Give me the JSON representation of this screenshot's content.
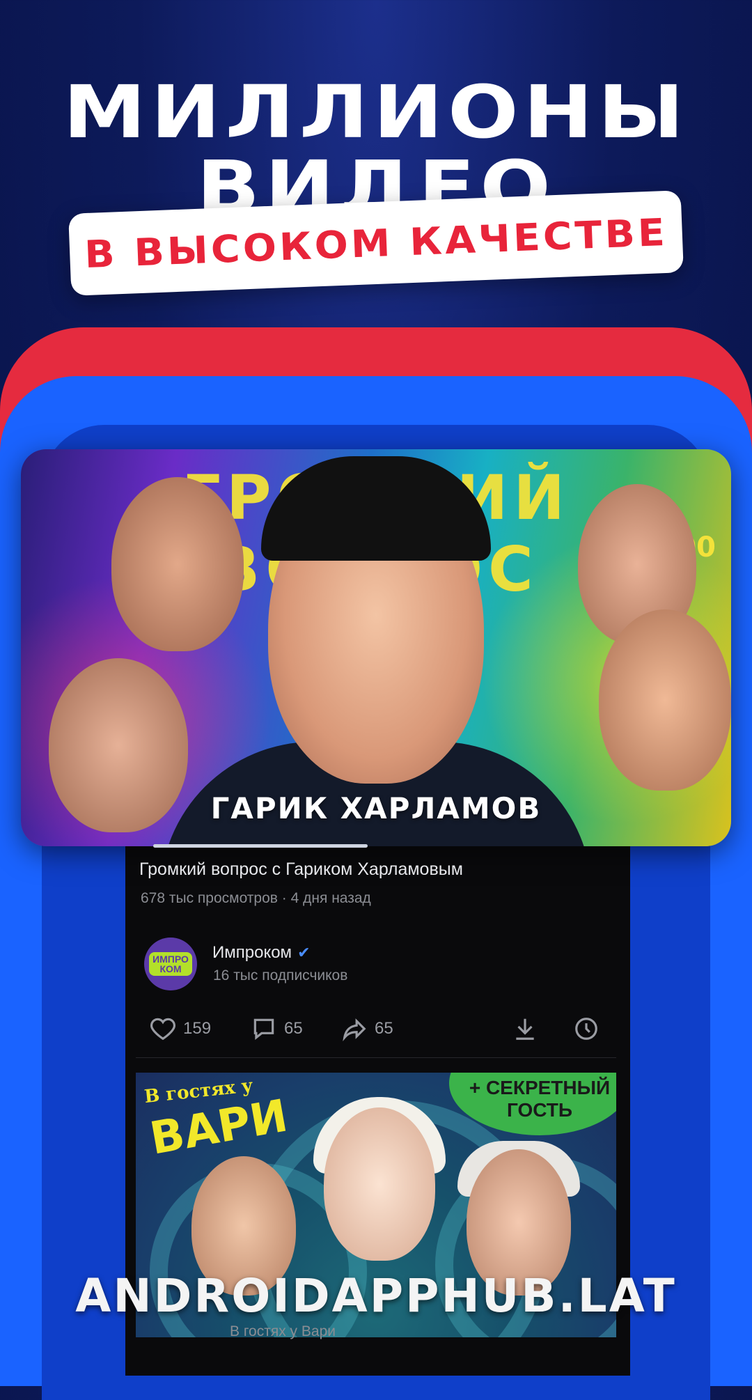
{
  "promo": {
    "line1": "МИЛЛИОНЫ",
    "line2": "ВИДЕО",
    "highlight": "В ВЫСОКОМ КАЧЕСТВЕ"
  },
  "colors": {
    "accent_red": "#e8243a",
    "frame_red": "#e52b3f",
    "frame_blue": "#1a63ff",
    "background": "#0d1a5a",
    "verified": "#4a8dff"
  },
  "video": {
    "thumbnail_title": "ГРОМКИЙ ВОПРОС",
    "thumbnail_tag": "≠100",
    "thumbnail_caption": "ГАРИК ХАРЛАМОВ",
    "progress_fraction": 0.3,
    "title": "Громкий вопрос с Гариком Харламовым",
    "views": "678 тыс просмотров",
    "separator": "·",
    "age": "4 дня назад"
  },
  "channel": {
    "avatar_text_top": "ИМПРО",
    "avatar_text_bottom": "КОМ",
    "name": "Импроком",
    "verified_icon": "check-icon",
    "subscribers": "16 тыс подписчиков"
  },
  "actions": {
    "likes": "159",
    "comments": "65",
    "shares": "65",
    "icons": [
      "heart-icon",
      "comment-icon",
      "share-icon",
      "download-icon",
      "clock-icon"
    ]
  },
  "next_video": {
    "tag_small": "В гостях у",
    "tag_big": "ВАРИ",
    "badge": "+ СЕКРЕТНЫЙ ГОСТЬ",
    "caption": "В гостях у Вари"
  },
  "watermark": "ANDROIDAPPHUB.LAT"
}
